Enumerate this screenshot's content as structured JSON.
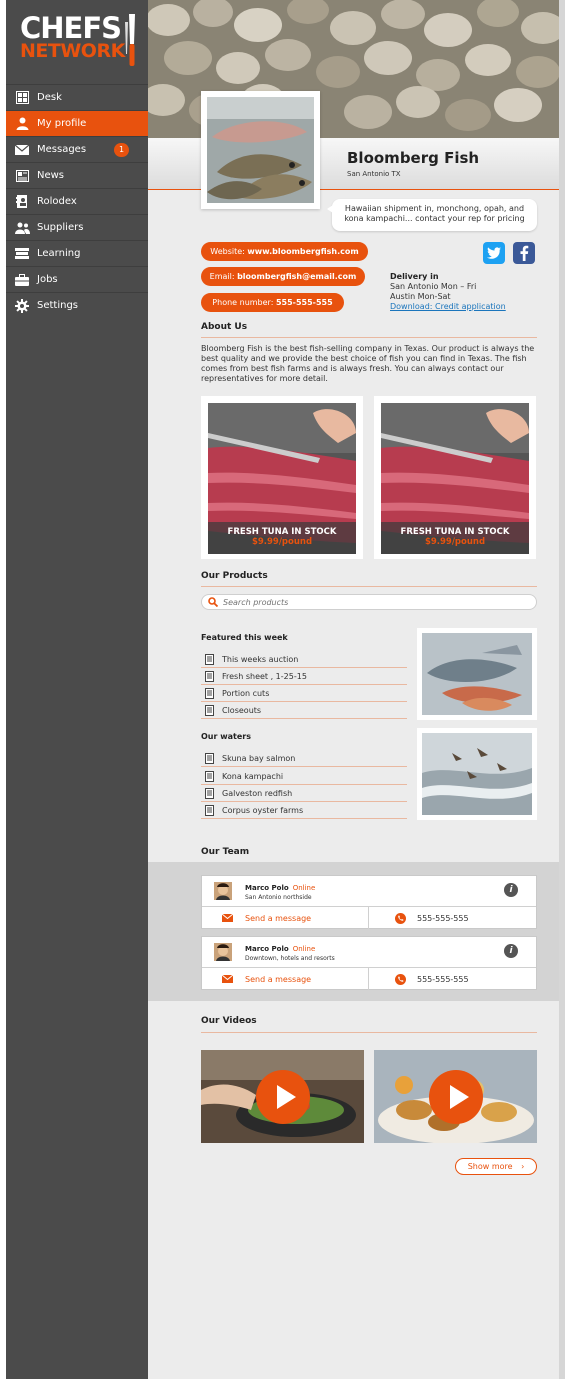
{
  "brand": {
    "line1": "CHEFS",
    "line2": "NETWORK"
  },
  "nav": [
    {
      "label": "Desk",
      "icon": "grid-icon"
    },
    {
      "label": "My profile",
      "icon": "person-icon",
      "active": true
    },
    {
      "label": "Messages",
      "icon": "envelope-icon",
      "badge": "1"
    },
    {
      "label": "News",
      "icon": "newspaper-icon"
    },
    {
      "label": "Rolodex",
      "icon": "rolodex-icon"
    },
    {
      "label": "Suppliers",
      "icon": "people-icon"
    },
    {
      "label": "Learning",
      "icon": "books-icon"
    },
    {
      "label": "Jobs",
      "icon": "briefcase-icon"
    },
    {
      "label": "Settings",
      "icon": "gear-icon"
    }
  ],
  "profile": {
    "name": "Bloomberg Fish",
    "location": "San Antonio TX",
    "bubble": "Hawaiian shipment in, monchong, opah, and kona kampachi... contact your rep for pricing"
  },
  "contact": {
    "website_label": "Website:",
    "website": "www.bloombergfish.com",
    "email_label": "Email:",
    "email": "bloombergfish@email.com",
    "phone_label": "Phone number:",
    "phone": "555-555-555"
  },
  "delivery": {
    "title": "Delivery in",
    "line1": "San Antonio Mon – Fri",
    "line2": "Austin Mon-Sat",
    "link": "Download: Credit application"
  },
  "about": {
    "title": "About Us",
    "text": "Bloomberg Fish is the best fish-selling company in Texas. Our product is always the best quality and we provide the best choice of fish you can find in Texas. The fish comes from best fish farms and is always fresh. You can always contact our representatives for more detail."
  },
  "specials": [
    {
      "title": "FRESH TUNA IN STOCK",
      "price": "$9.99/pound"
    },
    {
      "title": "FRESH TUNA IN STOCK",
      "price": "$9.99/pound"
    }
  ],
  "products": {
    "title": "Our Products",
    "search_placeholder": "Search products",
    "featured_title": "Featured this week",
    "featured": [
      "This weeks auction",
      "Fresh sheet , 1-25-15",
      "Portion cuts",
      "Closeouts"
    ],
    "waters_title": "Our waters",
    "waters": [
      "Skuna bay salmon",
      "Kona kampachi",
      "Galveston redfish",
      "Corpus oyster farms"
    ]
  },
  "team": {
    "title": "Our Team",
    "members": [
      {
        "name": "Marco Polo",
        "status": "Online",
        "area": "San Antonio northside",
        "message": "Send a message",
        "phone": "555-555-555"
      },
      {
        "name": "Marco Polo",
        "status": "Online",
        "area": "Downtown, hotels and resorts",
        "message": "Send a message",
        "phone": "555-555-555"
      }
    ]
  },
  "videos": {
    "title": "Our Videos",
    "show_more": "Show more"
  },
  "colors": {
    "accent": "#e8520e",
    "sidebar": "#4b4b4b",
    "twitter": "#1da1f2",
    "facebook": "#3b5998"
  }
}
